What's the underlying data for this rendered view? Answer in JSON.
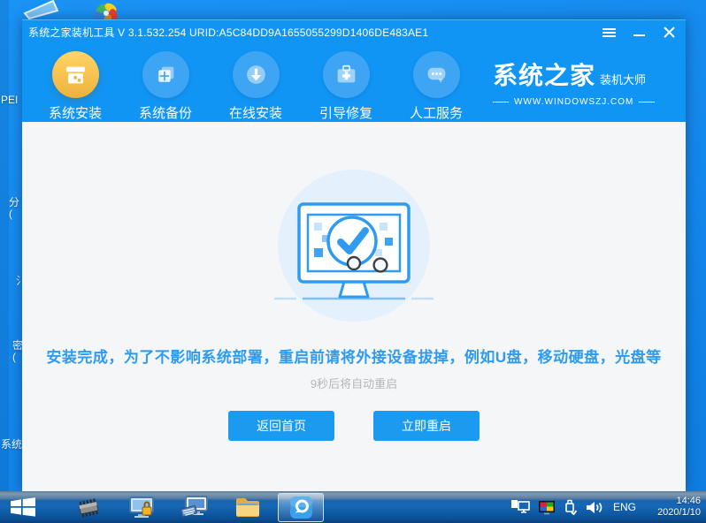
{
  "desktop": {
    "fragments": [
      "PEI",
      "分",
      "(",
      "氵",
      "密",
      "(",
      "系统"
    ]
  },
  "window": {
    "title": "系统之家装机工具 V 3.1.532.254 URID:A5C84DD9A1655055299D1406DE483AE1",
    "nav": {
      "items": [
        {
          "label": "系统安装",
          "active": true
        },
        {
          "label": "系统备份",
          "active": false
        },
        {
          "label": "在线安装",
          "active": false
        },
        {
          "label": "引导修复",
          "active": false
        },
        {
          "label": "人工服务",
          "active": false
        }
      ]
    },
    "logo": {
      "brand": "系统之家",
      "suffix": "装机大师",
      "site": "WWW.WINDOWSZJ.COM"
    },
    "main": {
      "message": "安装完成，为了不影响系统部署，重启前请将外接设备拔掉，例如U盘，移动硬盘，光盘等",
      "countdown": "9秒后将自动重启",
      "back_label": "返回首页",
      "restart_label": "立即重启"
    }
  },
  "taskbar": {
    "language": "ENG",
    "time": "14:46",
    "date": "2020/1/10"
  },
  "colors": {
    "header_blue": "#1095f5",
    "accent_blue": "#2e9bf0",
    "active_gold": "#f3bc45",
    "button_blue": "#1b9af0",
    "content_bg": "#f5f6f7"
  }
}
